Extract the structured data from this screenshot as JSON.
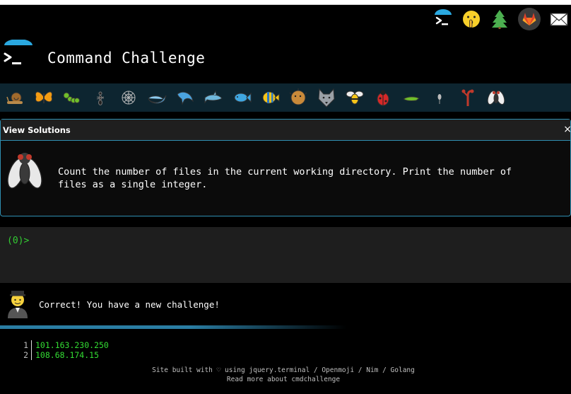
{
  "header": {
    "title": "Command Challenge",
    "logo_icon": "terminal-prompt-icon",
    "top_icons": [
      "terminal-icon",
      "shushing-face-icon",
      "tree-icon",
      "gitlab-icon",
      "mail-icon"
    ]
  },
  "animals": [
    "snail",
    "butterfly",
    "caterpillar",
    "ant",
    "spider-web",
    "whale",
    "dolphin",
    "dolphin-2",
    "fish",
    "tropical-fish",
    "blowfish",
    "wolf",
    "bee",
    "ladybug",
    "cricket",
    "mosquito",
    "scorpion",
    "fly"
  ],
  "solutions": {
    "header_label": "View Solutions",
    "close_glyph": "×",
    "challenge_line1": "Count the number of files in the current working directory. Print the number of",
    "challenge_line2": "files as a single integer."
  },
  "terminal": {
    "prompt": "(0)>"
  },
  "result": {
    "message": "Correct! You have a new challenge!"
  },
  "output_lines": [
    {
      "n": "1",
      "value": "101.163.230.250"
    },
    {
      "n": "2",
      "value": "108.68.174.15"
    }
  ],
  "footer": {
    "line1": "Site built with ♡ using jquery.terminal / Openmoji / Nim / Golang",
    "line2": "Read more about cmdchallenge"
  },
  "colors": {
    "accent": "#2f8fb1",
    "prompt_green": "#33cc33",
    "strip_bg": "#0d2530"
  }
}
